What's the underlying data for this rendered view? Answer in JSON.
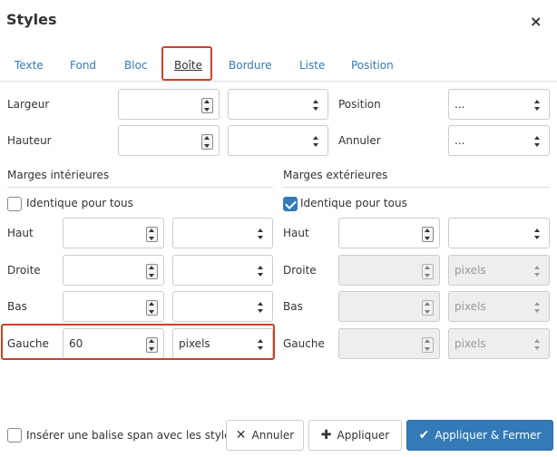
{
  "dialog": {
    "title": "Styles",
    "close_icon": "×"
  },
  "tabs": [
    {
      "label": "Texte"
    },
    {
      "label": "Fond"
    },
    {
      "label": "Bloc"
    },
    {
      "label": "Boîte",
      "active": true
    },
    {
      "label": "Bordure"
    },
    {
      "label": "Liste"
    },
    {
      "label": "Position"
    }
  ],
  "top": {
    "largeur_label": "Largeur",
    "hauteur_label": "Hauteur",
    "position_label": "Position",
    "annuler_label": "Annuler",
    "position_value": "...",
    "annuler_value": "..."
  },
  "padding": {
    "title": "Marges intérieures",
    "same_for_all_label": "Identique pour tous",
    "same_for_all_checked": false,
    "haut_label": "Haut",
    "droite_label": "Droite",
    "bas_label": "Bas",
    "gauche_label": "Gauche",
    "gauche_value": "60",
    "gauche_unit": "pixels"
  },
  "margin": {
    "title": "Marges extérieures",
    "same_for_all_label": "Identique pour tous",
    "same_for_all_checked": true,
    "haut_label": "Haut",
    "droite_label": "Droite",
    "bas_label": "Bas",
    "gauche_label": "Gauche",
    "droite_unit": "pixels",
    "bas_unit": "pixels",
    "gauche_unit": "pixels"
  },
  "footer": {
    "span_label": "Insérer une balise span avec les styles",
    "cancel_label": "Annuler",
    "apply_label": "Appliquer",
    "apply_close_label": "Appliquer & Fermer",
    "cancel_icon": "✕",
    "apply_icon": "✚",
    "apply_close_icon": "✔"
  },
  "colors": {
    "accent": "#337ab7",
    "highlight": "#c9422d"
  }
}
